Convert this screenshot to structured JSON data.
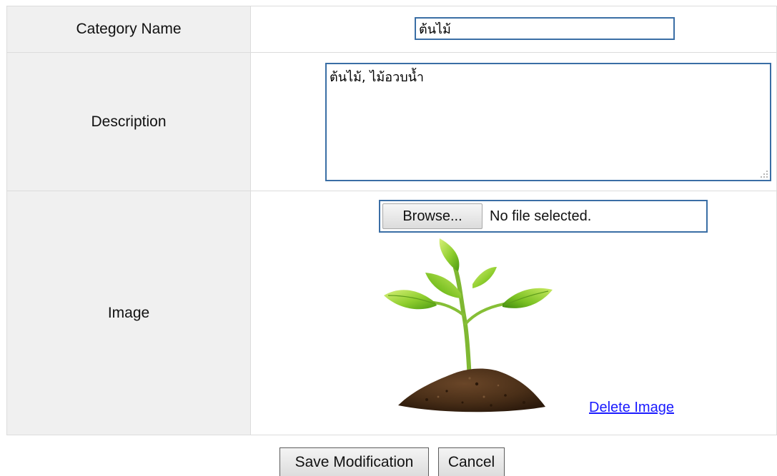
{
  "form": {
    "category_name": {
      "label": "Category Name",
      "value": "ต้นไม้"
    },
    "description": {
      "label": "Description",
      "value": "ต้นไม้, ไม้อวบน้ำ"
    },
    "image": {
      "label": "Image",
      "browse_label": "Browse...",
      "file_status": "No file selected.",
      "delete_label": "Delete Image",
      "preview_icon": "plant-sprout-image"
    }
  },
  "actions": {
    "save_label": "Save Modification",
    "cancel_label": "Cancel"
  },
  "colors": {
    "label_background": "#f0f0f0",
    "input_border": "#3a6ea5",
    "link": "#1a1aff"
  }
}
